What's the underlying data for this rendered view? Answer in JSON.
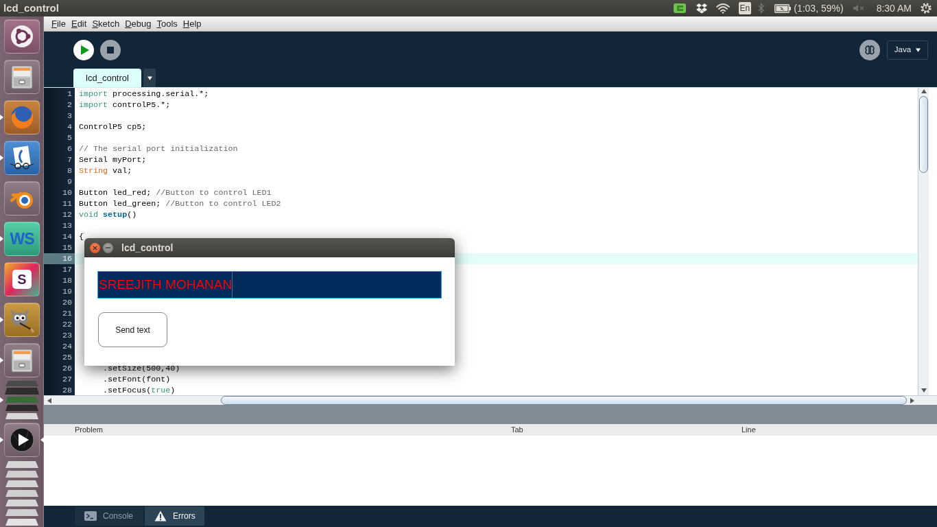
{
  "top_panel": {
    "title": "lcd_control",
    "keyboard_layout": "En",
    "battery": "(1:03, 59%)",
    "clock": "8:30 AM"
  },
  "launcher": {
    "items": [
      {
        "kind": "dash",
        "running": false,
        "focused": false
      },
      {
        "kind": "files",
        "running": false,
        "focused": false
      },
      {
        "kind": "browser",
        "running": true,
        "focused": false
      },
      {
        "kind": "viewer",
        "running": true,
        "focused": false
      },
      {
        "kind": "blender",
        "running": false,
        "focused": false
      },
      {
        "kind": "ide",
        "label": "WS",
        "running": true,
        "focused": false
      },
      {
        "kind": "chat",
        "label": "S",
        "running": false,
        "focused": false
      },
      {
        "kind": "paint",
        "running": true,
        "focused": false
      },
      {
        "kind": "files",
        "running": true,
        "focused": false
      },
      {
        "kind": "stack",
        "running": true,
        "focused": false
      },
      {
        "kind": "player",
        "running": true,
        "focused": true
      },
      {
        "kind": "stack",
        "running": false,
        "focused": false
      }
    ]
  },
  "menu": [
    "File",
    "Edit",
    "Sketch",
    "Debug",
    "Tools",
    "Help"
  ],
  "toolbar": {
    "mode": "Java"
  },
  "editor": {
    "tabs": [
      {
        "label": "lcd_control",
        "selected": true
      }
    ],
    "lines": [
      {
        "number": "1",
        "current": false,
        "tokens": [
          {
            "kind": "keyword",
            "text": "import"
          },
          {
            "kind": "plain",
            "text": " processing.serial.*;"
          }
        ]
      },
      {
        "number": "2",
        "current": false,
        "tokens": [
          {
            "kind": "keyword",
            "text": "import"
          },
          {
            "kind": "plain",
            "text": " controlP5.*;"
          }
        ]
      },
      {
        "number": "3",
        "current": false
      },
      {
        "number": "4",
        "current": false,
        "tokens": [
          {
            "kind": "plain",
            "text": "ControlP5 cp5;"
          }
        ]
      },
      {
        "number": "5",
        "current": false
      },
      {
        "number": "6",
        "current": false,
        "tokens": [
          {
            "kind": "comment",
            "text": "// The serial port initialization"
          }
        ]
      },
      {
        "number": "7",
        "current": false,
        "tokens": [
          {
            "kind": "plain",
            "text": "Serial myPort;"
          }
        ]
      },
      {
        "number": "8",
        "current": false,
        "tokens": [
          {
            "kind": "type",
            "text": "String"
          },
          {
            "kind": "plain",
            "text": " val;"
          }
        ]
      },
      {
        "number": "9",
        "current": false
      },
      {
        "number": "10",
        "current": false,
        "tokens": [
          {
            "kind": "plain",
            "text": "Button led_red; "
          },
          {
            "kind": "comment",
            "text": "//Button to control LED1"
          }
        ]
      },
      {
        "number": "11",
        "current": false,
        "tokens": [
          {
            "kind": "plain",
            "text": "Button led_green; "
          },
          {
            "kind": "comment",
            "text": "//Button to control LED2"
          }
        ]
      },
      {
        "number": "12",
        "current": false,
        "tokens": [
          {
            "kind": "keyword",
            "text": "void "
          },
          {
            "kind": "function",
            "text": "setup"
          },
          {
            "kind": "plain",
            "text": "()"
          }
        ]
      },
      {
        "number": "13",
        "current": false
      },
      {
        "number": "14",
        "current": false,
        "tokens": [
          {
            "kind": "plain",
            "text": "{"
          }
        ]
      },
      {
        "number": "15",
        "current": false
      },
      {
        "number": "16",
        "current": true
      },
      {
        "number": "17",
        "current": false
      },
      {
        "number": "18",
        "current": false
      },
      {
        "number": "19",
        "current": false
      },
      {
        "number": "20",
        "current": false
      },
      {
        "number": "21",
        "current": false
      },
      {
        "number": "22",
        "current": false
      },
      {
        "number": "23",
        "current": false
      },
      {
        "number": "24",
        "current": false
      },
      {
        "number": "25",
        "current": false
      },
      {
        "number": "26",
        "current": false,
        "tokens": [
          {
            "kind": "plain",
            "text": "     .setSize(500,40)"
          }
        ]
      },
      {
        "number": "27",
        "current": false,
        "tokens": [
          {
            "kind": "plain",
            "text": "     .setFont(font)"
          }
        ]
      },
      {
        "number": "28",
        "current": false,
        "tokens": [
          {
            "kind": "plain",
            "text": "     .setFocus("
          },
          {
            "kind": "literal",
            "text": "true"
          },
          {
            "kind": "plain",
            "text": ")"
          }
        ]
      }
    ]
  },
  "problems": {
    "columns": [
      "Problem",
      "Tab",
      "Line"
    ]
  },
  "bottom_tabs": [
    {
      "kind": "console",
      "label": "Console",
      "selected": false
    },
    {
      "kind": "errors",
      "label": "Errors",
      "selected": true
    }
  ],
  "dialog": {
    "title": "lcd_control",
    "field": {
      "value": "SREEJITH MOHANAN",
      "focused": true
    },
    "button": "Send text"
  }
}
